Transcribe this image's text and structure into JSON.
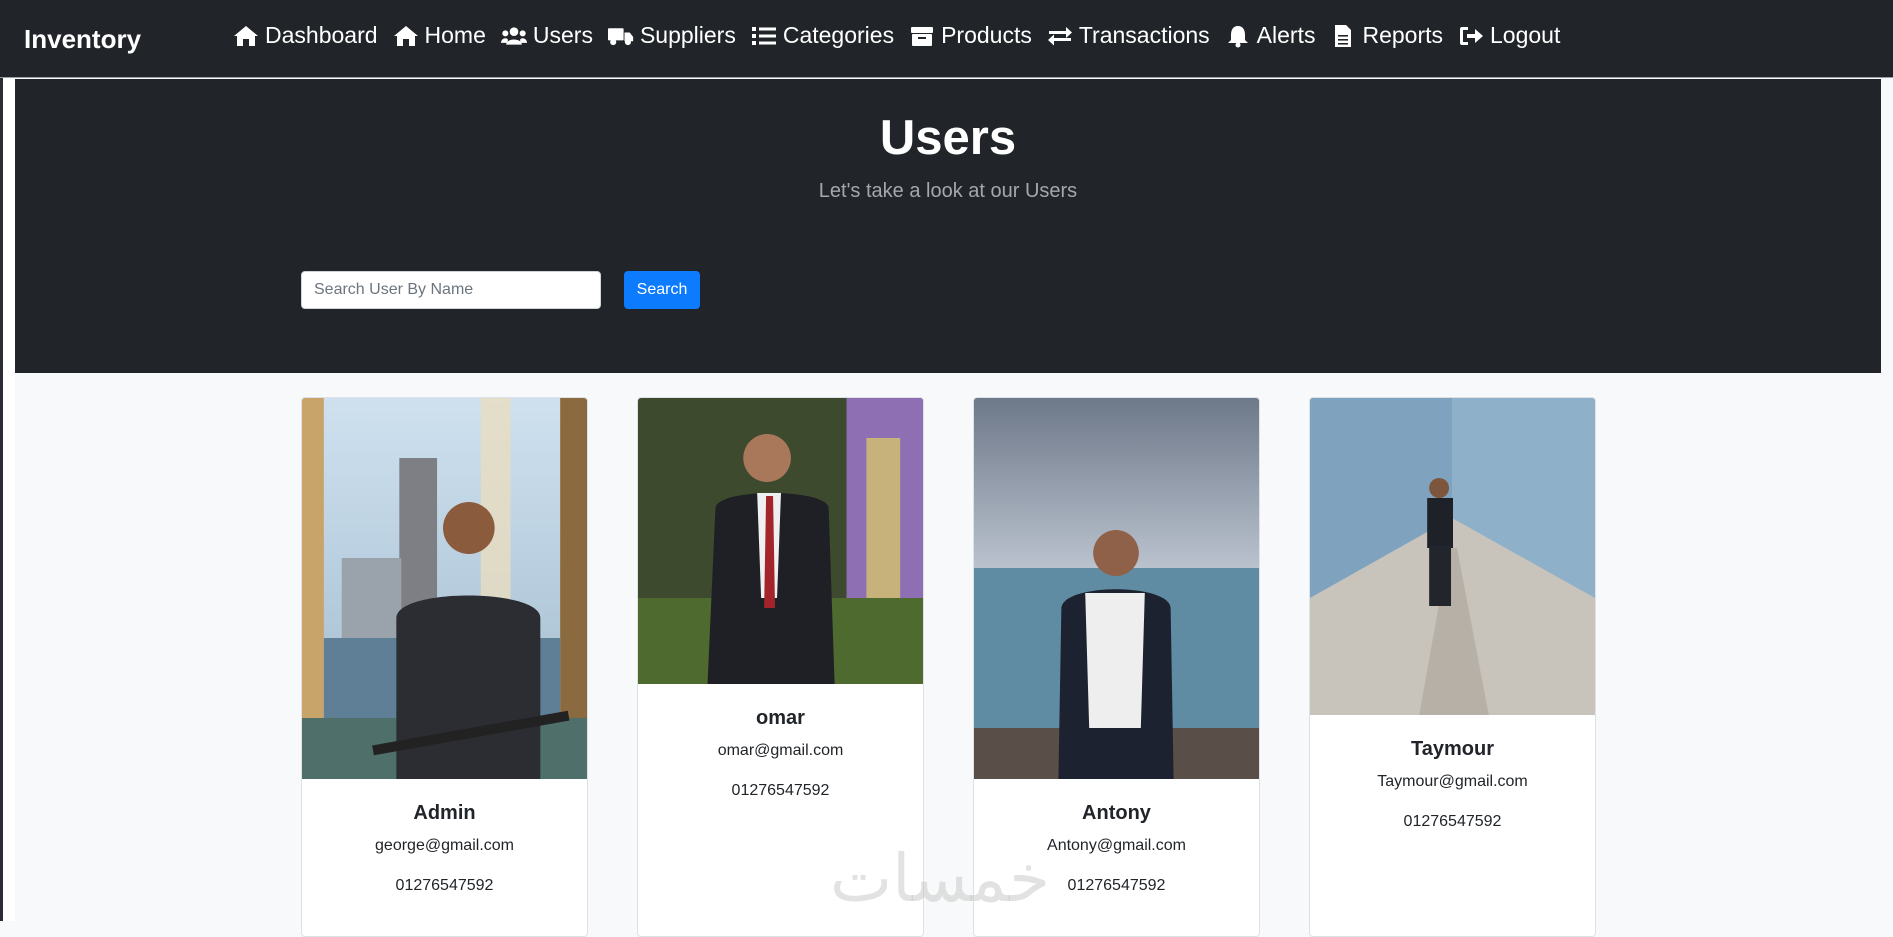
{
  "navbar": {
    "brand": "Inventory",
    "items": [
      {
        "label": "Dashboard",
        "icon": "home-icon"
      },
      {
        "label": "Home",
        "icon": "home-icon"
      },
      {
        "label": "Users",
        "icon": "users-icon"
      },
      {
        "label": "Suppliers",
        "icon": "truck-icon"
      },
      {
        "label": "Categories",
        "icon": "list-icon"
      },
      {
        "label": "Products",
        "icon": "box-icon"
      },
      {
        "label": "Transactions",
        "icon": "exchange-icon"
      },
      {
        "label": "Alerts",
        "icon": "bell-icon"
      },
      {
        "label": "Reports",
        "icon": "file-icon"
      },
      {
        "label": "Logout",
        "icon": "sign-out-icon"
      }
    ]
  },
  "hero": {
    "title": "Users",
    "subtitle": "Let's take a look at our Users"
  },
  "search": {
    "placeholder": "Search User By Name",
    "value": "",
    "button_label": "Search"
  },
  "users": [
    {
      "name": "Admin",
      "email": "george@gmail.com",
      "phone": "01276547592"
    },
    {
      "name": "omar",
      "email": "omar@gmail.com",
      "phone": "01276547592"
    },
    {
      "name": "Antony",
      "email": "Antony@gmail.com",
      "phone": "01276547592"
    },
    {
      "name": "Taymour",
      "email": "Taymour@gmail.com",
      "phone": "01276547592"
    }
  ],
  "watermark": "خمسات",
  "colors": {
    "navbar_bg": "#212529",
    "hero_bg": "#212529",
    "page_bg": "#f8f9fa",
    "primary": "#0d7bfe"
  }
}
